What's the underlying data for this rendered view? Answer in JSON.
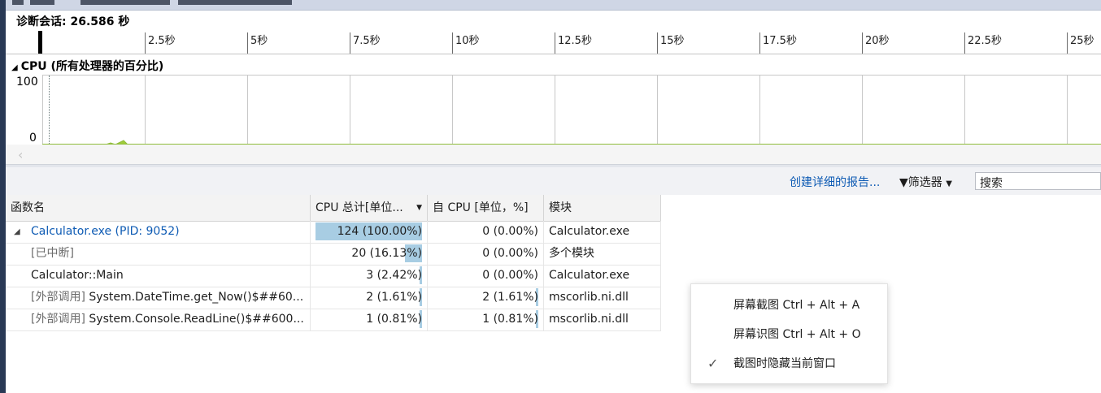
{
  "session": {
    "label": "诊断会话: 26.586 秒"
  },
  "ruler": {
    "ticks": [
      "2.5秒",
      "5秒",
      "7.5秒",
      "10秒",
      "12.5秒",
      "15秒",
      "17.5秒",
      "20秒",
      "22.5秒",
      "25秒"
    ]
  },
  "cpu_graph": {
    "title": "CPU (所有处理器的百分比)",
    "y_max": "100",
    "y_min": "0"
  },
  "toolbar": {
    "report_link": "创建详细的报告...",
    "filter_label": "筛选器",
    "search_value": "搜索"
  },
  "table": {
    "columns": [
      "函数名",
      "CPU 总计[单位...",
      "自 CPU [单位，%]",
      "模块"
    ],
    "rows": [
      {
        "name": "Calculator.exe (PID: 9052)",
        "total": "124 (100.00%)",
        "self": "0 (0.00%)",
        "module": "Calculator.exe",
        "total_pct": 100,
        "self_pct": 0
      },
      {
        "name": "[已中断]",
        "total": "20 (16.13%)",
        "self": "0 (0.00%)",
        "module": "多个模块",
        "total_pct": 16.13,
        "self_pct": 0
      },
      {
        "name": "Calculator::Main",
        "total": "3 (2.42%)",
        "self": "0 (0.00%)",
        "module": "Calculator.exe",
        "total_pct": 2.42,
        "self_pct": 0
      },
      {
        "name_prefix": "[外部调用]",
        "name": "System.DateTime.get_Now()$##60...",
        "total": "2 (1.61%)",
        "self": "2 (1.61%)",
        "module": "mscorlib.ni.dll",
        "total_pct": 1.61,
        "self_pct": 1.61
      },
      {
        "name_prefix": "[外部调用]",
        "name": "System.Console.ReadLine()$##600...",
        "total": "1 (0.81%)",
        "self": "1 (0.81%)",
        "module": "mscorlib.ni.dll",
        "total_pct": 0.81,
        "self_pct": 0.81
      }
    ]
  },
  "context_menu": {
    "items": [
      {
        "label": "屏幕截图 Ctrl + Alt + A",
        "checked": false
      },
      {
        "label": "屏幕识图 Ctrl + Alt + O",
        "checked": false
      },
      {
        "label": "截图时隐藏当前窗口",
        "checked": true
      }
    ]
  },
  "colors": {
    "accent": "#0e5bb4",
    "bar": "#a8cde3",
    "cpu_line": "#8fbc3a"
  }
}
